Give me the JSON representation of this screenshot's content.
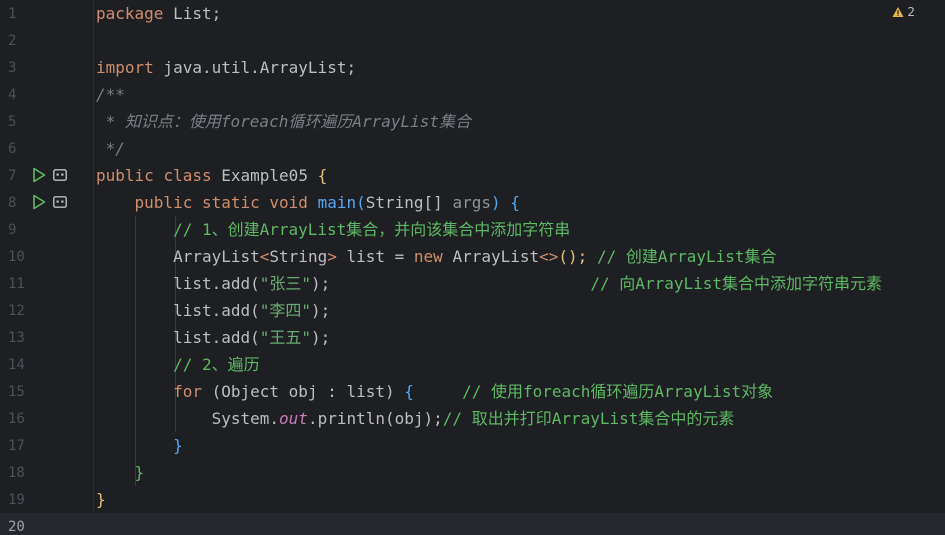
{
  "editor": {
    "warnings_count": "2",
    "warning_icon": "warning-triangle-icon",
    "accent_colors": {
      "keyword": "#cf8e6d",
      "string": "#6aab73",
      "comment_doc": "#7a7e85",
      "comment": "#5fb865",
      "function": "#56a8f5",
      "run_icon": "#5fb865"
    },
    "lines": [
      {
        "num": "1"
      },
      {
        "num": "2"
      },
      {
        "num": "3"
      },
      {
        "num": "4"
      },
      {
        "num": "5"
      },
      {
        "num": "6"
      },
      {
        "num": "7"
      },
      {
        "num": "8"
      },
      {
        "num": "9"
      },
      {
        "num": "10"
      },
      {
        "num": "11"
      },
      {
        "num": "12"
      },
      {
        "num": "13"
      },
      {
        "num": "14"
      },
      {
        "num": "15"
      },
      {
        "num": "16"
      },
      {
        "num": "17"
      },
      {
        "num": "18"
      },
      {
        "num": "19"
      },
      {
        "num": "20"
      }
    ],
    "code": {
      "l1_kw": "package",
      "l1_rest": " List;",
      "l3_kw": "import",
      "l3_rest": " java.util.ArrayList;",
      "l4": "/**",
      "l5": " * 知识点：使用foreach循环遍历ArrayList集合",
      "l6": " */",
      "l7_kw1": "public",
      "l7_kw2": "class",
      "l7_name": "Example05",
      "l7_brace": "{",
      "l8_kw1": "public",
      "l8_kw2": "static",
      "l8_kw3": "void",
      "l8_fn": "main",
      "l8_type": "String[]",
      "l8_param": "args",
      "l8_brace": "{",
      "l9": "// 1、创建ArrayList集合，并向该集合中添加字符串",
      "l10_type": "ArrayList",
      "l10_generic": "String",
      "l10_mid": " list = ",
      "l10_new": "new",
      "l10_ctor": " ArrayList",
      "l10_diamond": "<>",
      "l10_end": "();",
      "l10_comment": " // 创建ArrayList集合",
      "l11_code": "list.add(",
      "l11_str": "\"张三\"",
      "l11_end": ");",
      "l11_comment": "// 向ArrayList集合中添加字符串元素",
      "l12_code": "list.add(",
      "l12_str": "\"李四\"",
      "l12_end": ");",
      "l13_code": "list.add(",
      "l13_str": "\"王五\"",
      "l13_end": ");",
      "l14": "// 2、遍历",
      "l15_kw": "for",
      "l15_mid": " (Object obj : list) ",
      "l15_brace": "{",
      "l15_comment": "// 使用foreach循环遍历ArrayList对象",
      "l16_a": "System.",
      "l16_out": "out",
      "l16_b": ".println(obj);",
      "l16_comment": "// 取出并打印ArrayList集合中的元素",
      "l17": "}",
      "l18": "}",
      "l19": "}"
    }
  }
}
